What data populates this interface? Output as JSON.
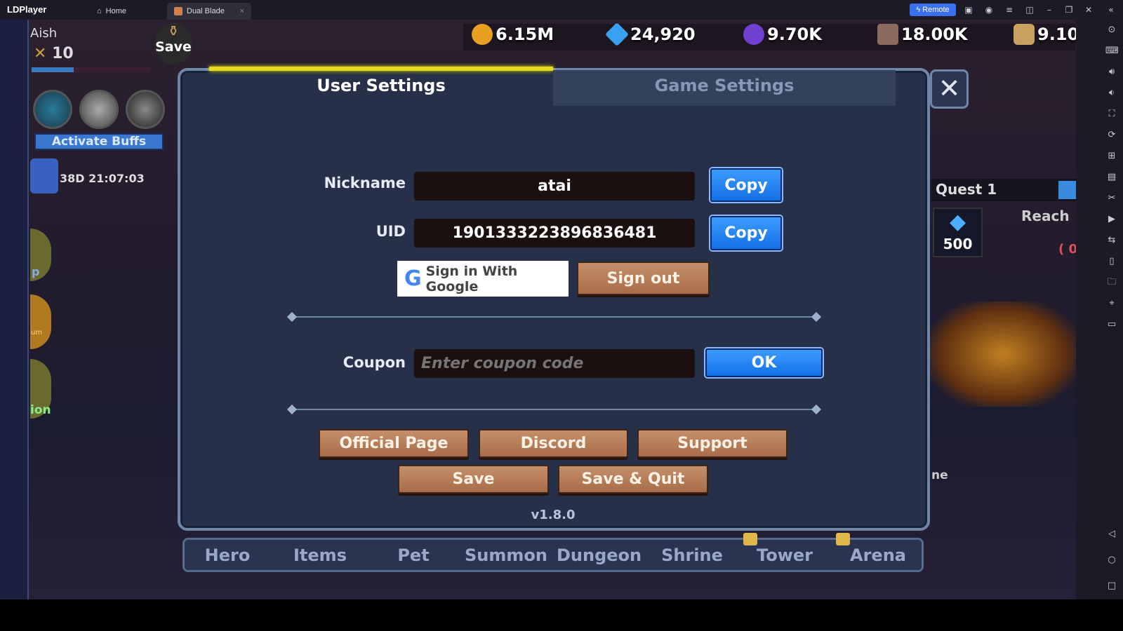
{
  "window": {
    "app_name": "LDPlayer",
    "tabs": [
      {
        "label": "Home",
        "icon": "home-icon"
      },
      {
        "label": "Dual Blade",
        "icon": "game-icon",
        "active": true
      }
    ],
    "remote_label": "Remote"
  },
  "hud": {
    "player_name": "Aish",
    "level": "10",
    "save_label": "Save",
    "currencies": [
      {
        "icon": "coin-icon",
        "value": "6.15M",
        "color": "#e8a020"
      },
      {
        "icon": "blue-gem-icon",
        "value": "24,920",
        "color": "#3aa0f0"
      },
      {
        "icon": "purple-gem-icon",
        "value": "9.70K",
        "color": "#7040d0"
      },
      {
        "icon": "scroll-icon",
        "value": "18.00K",
        "color": "#8a6a5a"
      },
      {
        "icon": "bone-icon",
        "value": "9.10"
      }
    ],
    "activate_buffs": "Activate Buffs",
    "timer": "38D 21:07:03",
    "side_labels": [
      "p",
      "um",
      "ion"
    ],
    "quest": {
      "title": "Quest 1",
      "reward": "500",
      "desc": "Reach",
      "progress": "( 0"
    },
    "partial_label": "ne"
  },
  "dialog": {
    "tabs": [
      {
        "label": "User Settings",
        "active": true
      },
      {
        "label": "Game Settings"
      }
    ],
    "nickname_label": "Nickname",
    "nickname_value": "atai",
    "uid_label": "UID",
    "uid_value": "1901333223896836481",
    "copy_label": "Copy",
    "google_label": "Sign in With Google",
    "signout_label": "Sign out",
    "coupon_label": "Coupon",
    "coupon_placeholder": "Enter coupon code",
    "ok_label": "OK",
    "buttons": [
      "Official Page",
      "Discord",
      "Support",
      "Save",
      "Save & Quit"
    ],
    "version": "v1.8.0"
  },
  "nav": [
    {
      "label": "Hero"
    },
    {
      "label": "Items"
    },
    {
      "label": "Pet"
    },
    {
      "label": "Summon"
    },
    {
      "label": "Dungeon"
    },
    {
      "label": "Shrine"
    },
    {
      "label": "Tower",
      "locked": true
    },
    {
      "label": "Arena",
      "locked": true
    }
  ]
}
